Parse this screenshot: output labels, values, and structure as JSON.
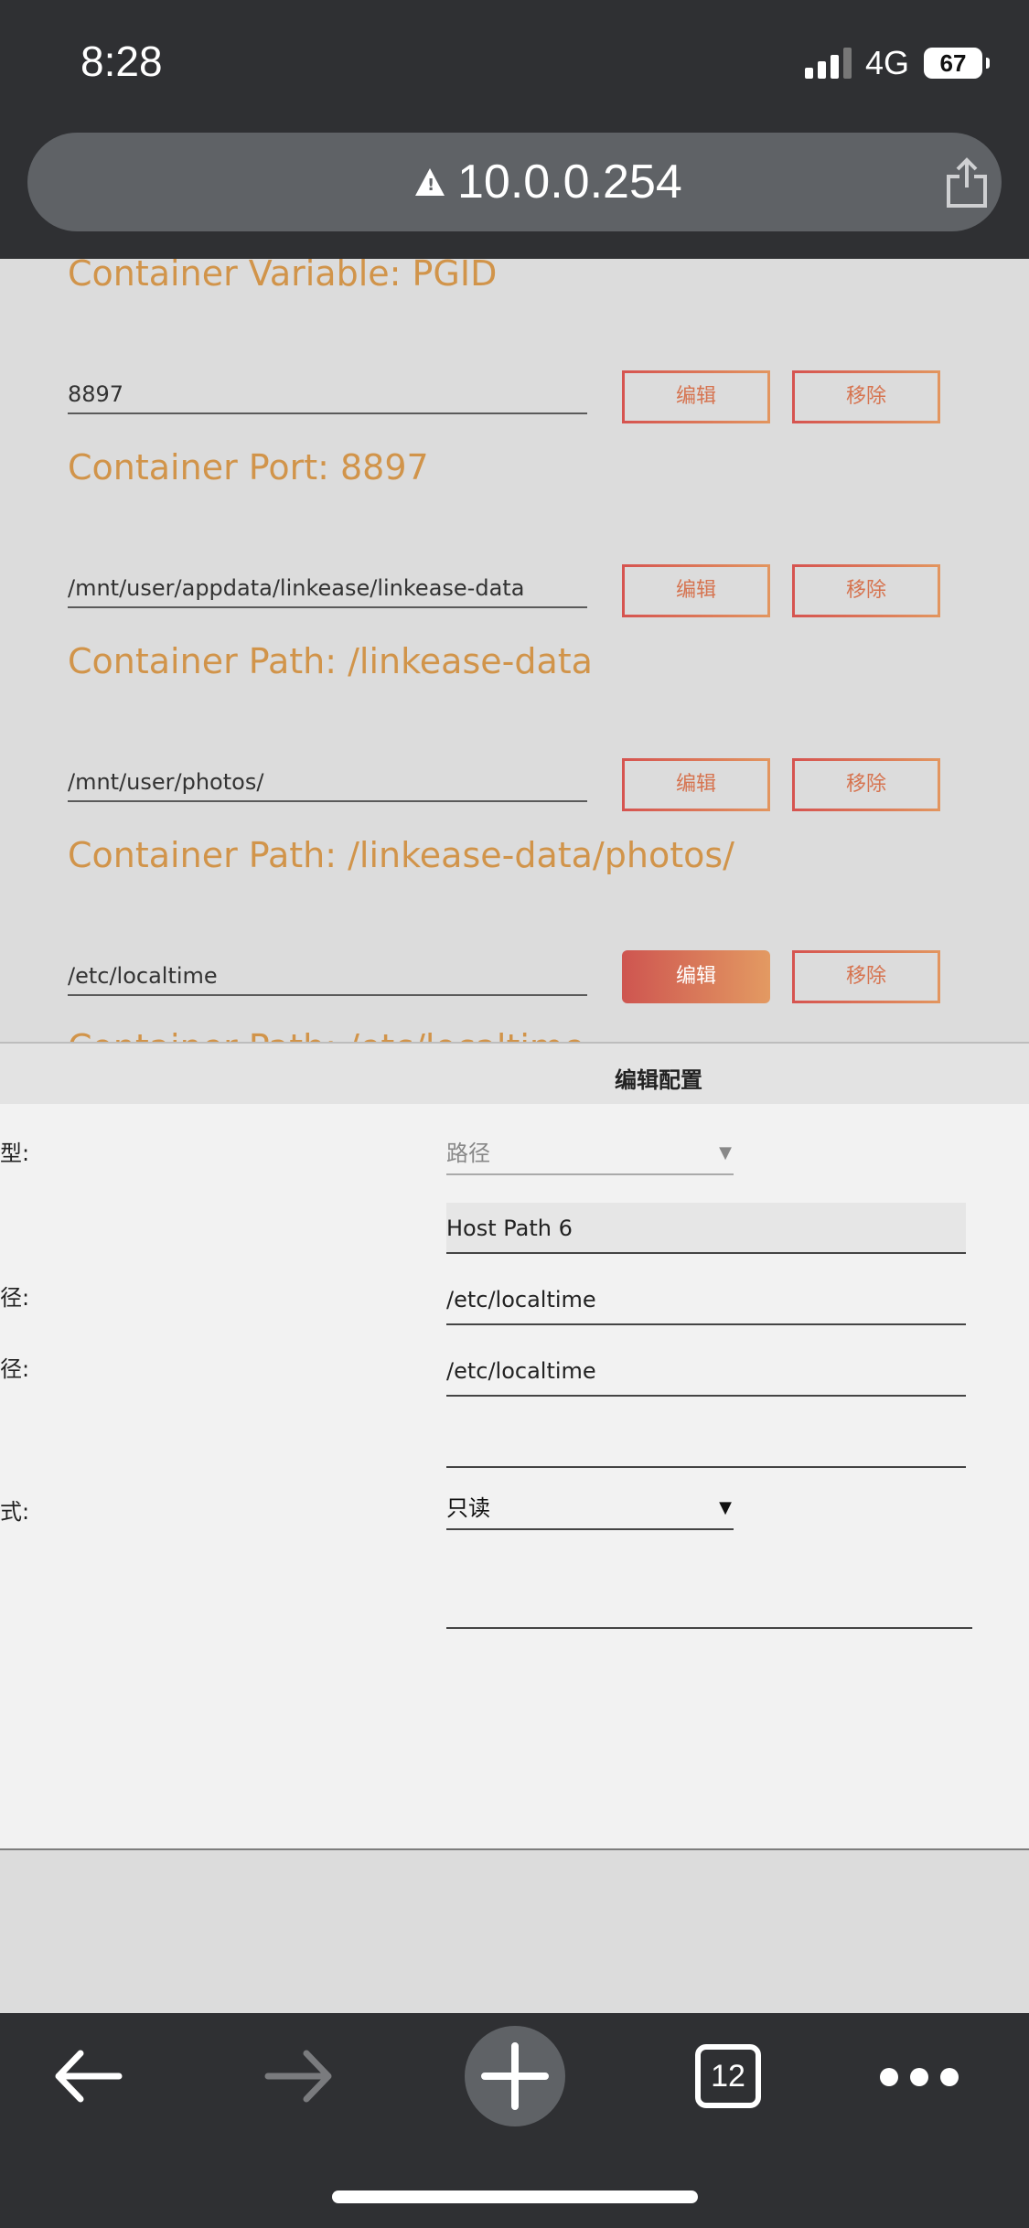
{
  "status_bar": {
    "time": "8:28",
    "network": "4G",
    "battery": "67"
  },
  "url_bar": {
    "url": "10.0.0.254",
    "warning_icon": "warning-icon",
    "share_icon": "share-icon"
  },
  "page": {
    "sections": [
      {
        "title": "Container Variable: PGID"
      },
      {
        "title": "Container Port: 8897"
      },
      {
        "title": "Container Path: /linkease-data"
      },
      {
        "title": "Container Path: /linkease-data/photos/"
      },
      {
        "title": "Container Path: /etc/localtime"
      }
    ],
    "entries": [
      {
        "value": "8897",
        "edit": "编辑",
        "remove": "移除"
      },
      {
        "value": "/mnt/user/appdata/linkease/linkease-data",
        "edit": "编辑",
        "remove": "移除"
      },
      {
        "value": "/mnt/user/photos/",
        "edit": "编辑",
        "remove": "移除"
      },
      {
        "value": "/etc/localtime",
        "edit": "编辑",
        "remove": "移除"
      }
    ]
  },
  "sheet": {
    "title": "编辑配置",
    "labels": [
      "型:",
      "径:",
      "径:",
      "式:"
    ],
    "type_select": "路径",
    "name_value": "Host Path 6",
    "container_path": "/etc/localtime",
    "host_path": "/etc/localtime",
    "default_value": "",
    "access_mode": "只读",
    "description": ""
  },
  "toolbar": {
    "tab_count": "12"
  },
  "colors": {
    "accent": "#d1944a",
    "button_border": "#d46452",
    "chrome": "#2f3033"
  }
}
